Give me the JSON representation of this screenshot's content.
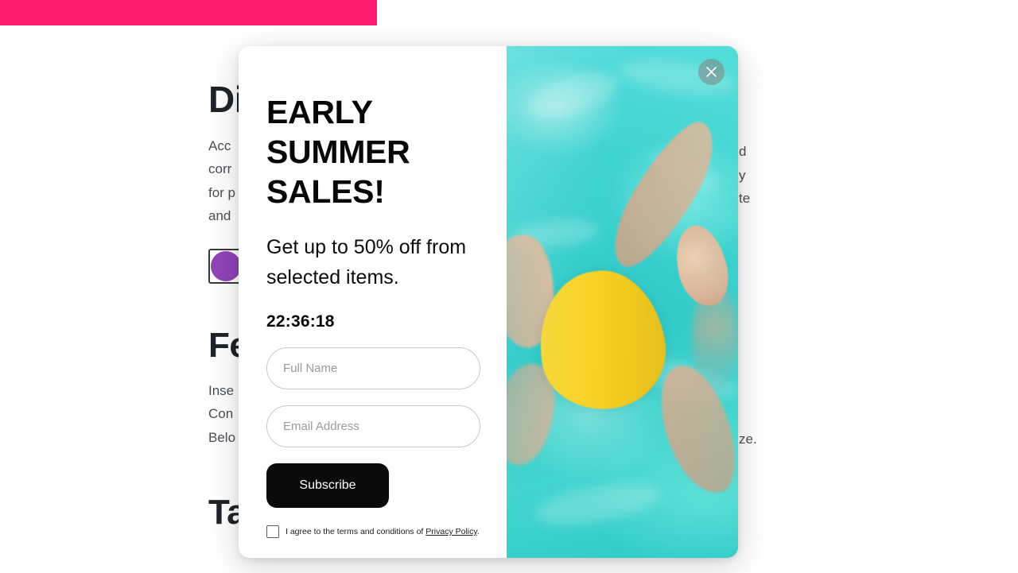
{
  "background_page": {
    "banner_color": "#fc1a6e",
    "heading_1": "Di",
    "paragraph_1_lines": [
      "Acc",
      "corr",
      "for p",
      "and"
    ],
    "paragraph_1_right_fragments": [
      "d",
      "y",
      "te"
    ],
    "swatch_color": "#8f44b8",
    "heading_2": "Fe",
    "paragraph_2_lines": [
      "Inse",
      "Con",
      "Belo"
    ],
    "paragraph_2_right_fragment": "ze.",
    "heading_3": "Ta"
  },
  "modal": {
    "close_icon": "close-icon",
    "title": "EARLY SUMMER SALES!",
    "subtitle": "Get up to 50% off from selected items.",
    "countdown": "22:36:18",
    "fields": {
      "full_name": {
        "value": "",
        "placeholder": "Full Name"
      },
      "email": {
        "value": "",
        "placeholder": "Email Address"
      }
    },
    "subscribe_label": "Subscribe",
    "terms": {
      "checked": false,
      "text": "I agree to the terms and conditions of ",
      "link_label": "Privacy Policy",
      "suffix": "."
    },
    "image": {
      "alt": "woman-floating-in-pool-photo",
      "water_color": "#35d0cd",
      "swimsuit_color": "#f5cf25"
    }
  }
}
